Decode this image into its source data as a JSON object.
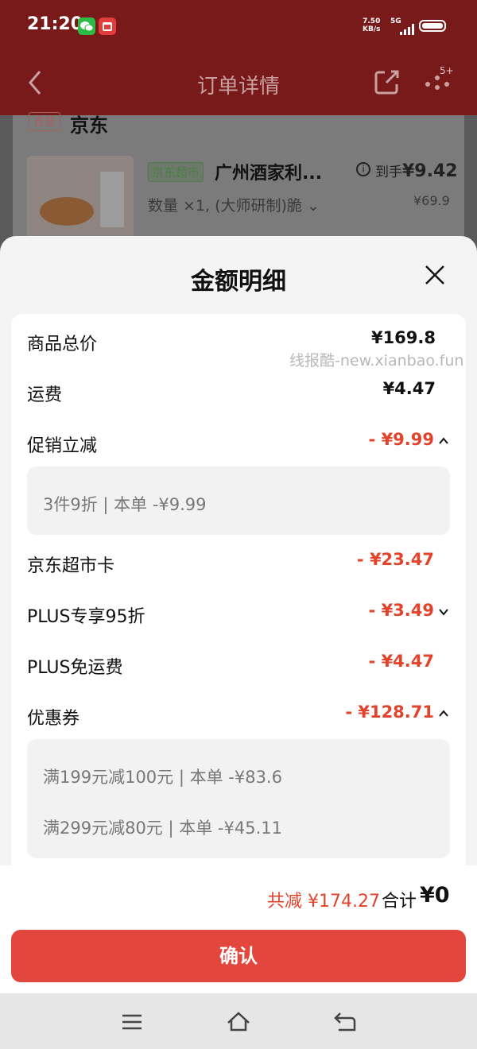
{
  "status_bar": {
    "time": "21:20",
    "net_speed_value": "7.50",
    "net_speed_unit": "KB/s",
    "network": "5G"
  },
  "header": {
    "title": "订单详情",
    "badge": "5+"
  },
  "background_card": {
    "self_tag": "自营",
    "shop": "京东",
    "market_tag": "京东超市",
    "product_title": "广州酒家利...",
    "final_price_prefix": "到手",
    "final_price": "¥9.42",
    "quantity_text": "数量 ×1, (大师研制)脆",
    "original_price": "¥69.9"
  },
  "sheet": {
    "title": "金额明细",
    "rows": [
      {
        "label": "商品总价",
        "value": "¥169.8"
      },
      {
        "label": "运费",
        "value": "¥4.47"
      },
      {
        "label": "促销立减",
        "value": "- ¥9.99"
      },
      {
        "label": "京东超市卡",
        "value": "- ¥23.47"
      },
      {
        "label": "PLUS专享95折",
        "value": "- ¥3.49"
      },
      {
        "label": "PLUS免运费",
        "value": "- ¥4.47"
      },
      {
        "label": "优惠券",
        "value": "- ¥128.71"
      }
    ],
    "promo_detail": [
      "3件9折 | 本单 -¥9.99"
    ],
    "coupon_detail": [
      "满199元减100元 | 本单 -¥83.6",
      "满299元减80元 | 本单 -¥45.11"
    ]
  },
  "watermark": "线报酷-new.xianbao.fun",
  "footer": {
    "saved": "共减 ¥174.27",
    "total_label": "合计",
    "total_value": "¥0",
    "confirm_label": "确认"
  },
  "colors": {
    "accent": "#e2432b",
    "button": "#e2463c",
    "header_bg": "#781a1a"
  }
}
